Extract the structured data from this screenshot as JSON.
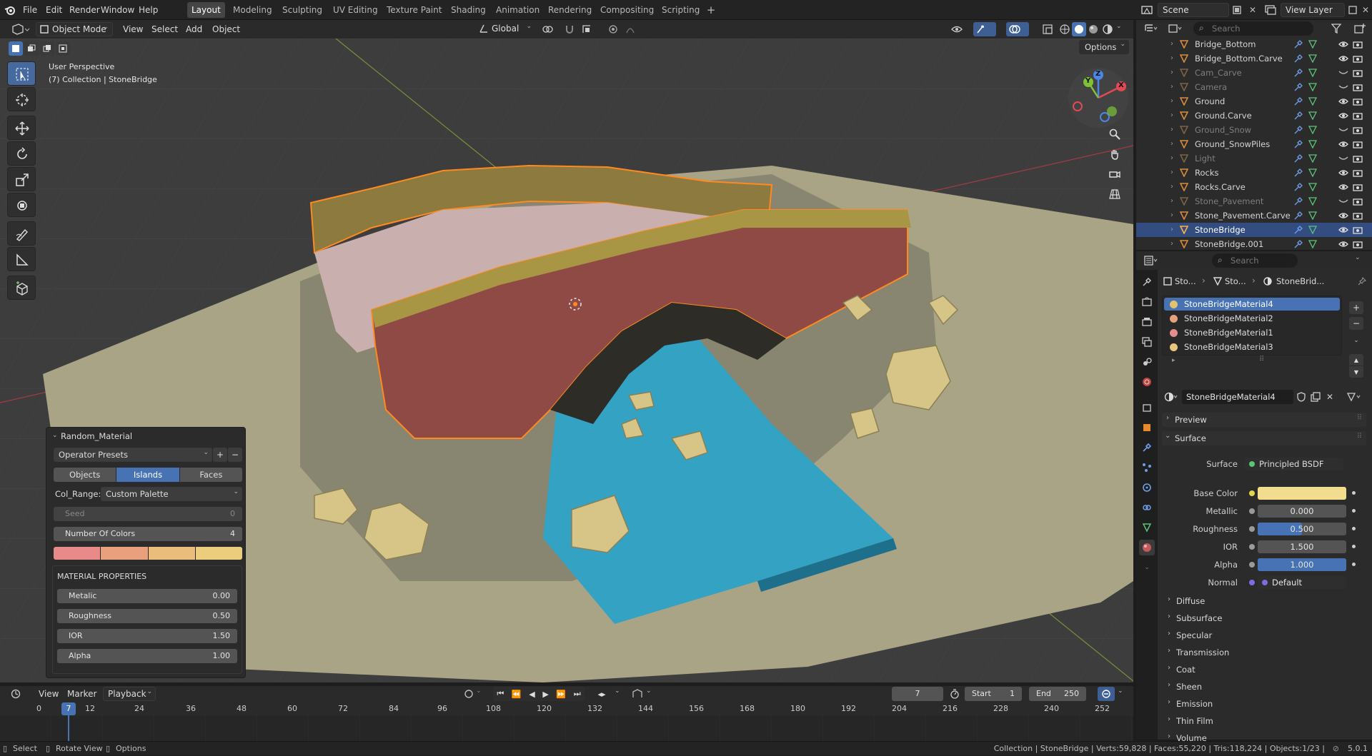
{
  "topbar": {
    "menus": [
      "File",
      "Edit",
      "Render",
      "Window",
      "Help"
    ],
    "workspaces": [
      "Layout",
      "Modeling",
      "Sculpting",
      "UV Editing",
      "Texture Paint",
      "Shading",
      "Animation",
      "Rendering",
      "Compositing",
      "Scripting"
    ],
    "active_workspace": "Layout",
    "scene": "Scene",
    "view_layer": "View Layer"
  },
  "viewport_header": {
    "mode": "Object Mode",
    "menus": [
      "View",
      "Select",
      "Add",
      "Object"
    ],
    "transform_orientation": "Global",
    "options": "Options"
  },
  "viewport": {
    "perspective": "User Perspective",
    "collection_info": "(7) Collection | StoneBridge",
    "gizmo_axes": [
      "Z",
      "Y",
      "X"
    ]
  },
  "operator_panel": {
    "title": "Random_Material",
    "presets": "Operator Presets",
    "mode_tabs": [
      "Objects",
      "Islands",
      "Faces"
    ],
    "active_mode": "Islands",
    "col_range_label": "Col_Range:",
    "col_range_value": "Custom Palette",
    "seed_label": "Seed",
    "seed_value": "0",
    "num_colors_label": "Number Of Colors",
    "num_colors_value": "4",
    "palette": [
      "#e98a8a",
      "#e9a17d",
      "#ebbd7c",
      "#ebcd7d"
    ],
    "material_heading": "MATERIAL PROPERTIES",
    "props": [
      {
        "label": "Metalic",
        "value": "0.00"
      },
      {
        "label": "Roughness",
        "value": "0.50"
      },
      {
        "label": "IOR",
        "value": "1.50"
      },
      {
        "label": "Alpha",
        "value": "1.00"
      }
    ]
  },
  "timeline": {
    "menus": [
      "View",
      "Marker",
      "Playback"
    ],
    "current_frame": "7",
    "start_label": "Start",
    "start": "1",
    "end_label": "End",
    "end": "250",
    "ticks": [
      "0",
      "12",
      "24",
      "36",
      "48",
      "60",
      "72",
      "84",
      "96",
      "108",
      "120",
      "132",
      "144",
      "156",
      "168",
      "180",
      "192",
      "204",
      "216",
      "228",
      "240",
      "252"
    ],
    "playhead": "7"
  },
  "statusbar": {
    "left": [
      "Select",
      "Rotate View",
      "Options"
    ],
    "right": "Collection | StoneBridge | Verts:59,828 | Faces:55,220 | Tris:118,224 | Objects:1/23 |",
    "version": "5.0.1"
  },
  "outliner": {
    "search_placeholder": "Search",
    "items": [
      {
        "name": "Bridge_Bottom",
        "dim": false,
        "selected": false
      },
      {
        "name": "Bridge_Bottom.Carve",
        "dim": false,
        "selected": false
      },
      {
        "name": "Cam_Carve",
        "dim": true,
        "selected": false
      },
      {
        "name": "Camera",
        "dim": true,
        "selected": false
      },
      {
        "name": "Ground",
        "dim": false,
        "selected": false
      },
      {
        "name": "Ground.Carve",
        "dim": false,
        "selected": false
      },
      {
        "name": "Ground_Snow",
        "dim": true,
        "selected": false
      },
      {
        "name": "Ground_SnowPiles",
        "dim": false,
        "selected": false
      },
      {
        "name": "Light",
        "dim": true,
        "selected": false
      },
      {
        "name": "Rocks",
        "dim": false,
        "selected": false
      },
      {
        "name": "Rocks.Carve",
        "dim": false,
        "selected": false
      },
      {
        "name": "Stone_Pavement",
        "dim": true,
        "selected": false
      },
      {
        "name": "Stone_Pavement.Carve",
        "dim": false,
        "selected": false
      },
      {
        "name": "StoneBridge",
        "dim": false,
        "selected": true
      },
      {
        "name": "StoneBridge.001",
        "dim": false,
        "selected": false
      }
    ]
  },
  "properties": {
    "search_placeholder": "Search",
    "breadcrumb": [
      "Sto...",
      "Sto...",
      "StoneBrid..."
    ],
    "materials": [
      {
        "name": "StoneBridgeMaterial4",
        "color": "#e2c26e",
        "selected": true
      },
      {
        "name": "StoneBridgeMaterial2",
        "color": "#e6a27c",
        "selected": false
      },
      {
        "name": "StoneBridgeMaterial1",
        "color": "#e58d8d",
        "selected": false
      },
      {
        "name": "StoneBridgeMaterial3",
        "color": "#e8c77c",
        "selected": false
      }
    ],
    "active_material": "StoneBridgeMaterial4",
    "preview": "Preview",
    "surface_section": "Surface",
    "surface_label": "Surface",
    "surface_value": "Principled BSDF",
    "fields": [
      {
        "label": "Base Color",
        "value": "",
        "fill": 1.0,
        "color": "#f2dc8e"
      },
      {
        "label": "Metallic",
        "value": "0.000",
        "fill": 0.0,
        "color": "#4772b3"
      },
      {
        "label": "Roughness",
        "value": "0.500",
        "fill": 0.5,
        "color": "#4772b3"
      },
      {
        "label": "IOR",
        "value": "1.500",
        "fill": 0.0,
        "color": "#4772b3"
      },
      {
        "label": "Alpha",
        "value": "1.000",
        "fill": 1.0,
        "color": "#4772b3"
      },
      {
        "label": "Normal",
        "value": "Default",
        "fill": 0.0,
        "color": "#4772b3"
      }
    ],
    "sub_sections": [
      "Diffuse",
      "Subsurface",
      "Specular",
      "Transmission",
      "Coat",
      "Sheen",
      "Emission",
      "Thin Film",
      "Volume"
    ]
  }
}
